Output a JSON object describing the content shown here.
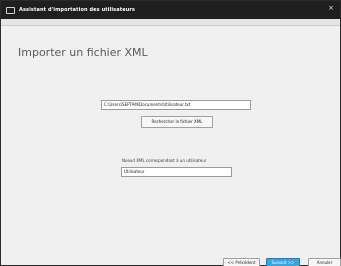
{
  "window": {
    "title": "Assistant d'importation des utilisateurs",
    "close_glyph": "×"
  },
  "page": {
    "heading": "Importer un fichier XML"
  },
  "file": {
    "path_value": "C:\\Users\\SEPTAM\\Documents\\Utilisateur.txt",
    "browse_label": "Rechercher le fichier XML"
  },
  "node": {
    "label": "Noeud XML correspondant à un utilisateur",
    "value": "Utilisateur"
  },
  "footer": {
    "prev_label": "<< Précédent",
    "next_label": "Suivant >>",
    "cancel_label": "Annuler"
  },
  "colors": {
    "titlebar": "#1f1f1f",
    "primary_button": "#3aa3e0"
  },
  "icons": {
    "app": "window-icon",
    "close": "close-icon"
  }
}
